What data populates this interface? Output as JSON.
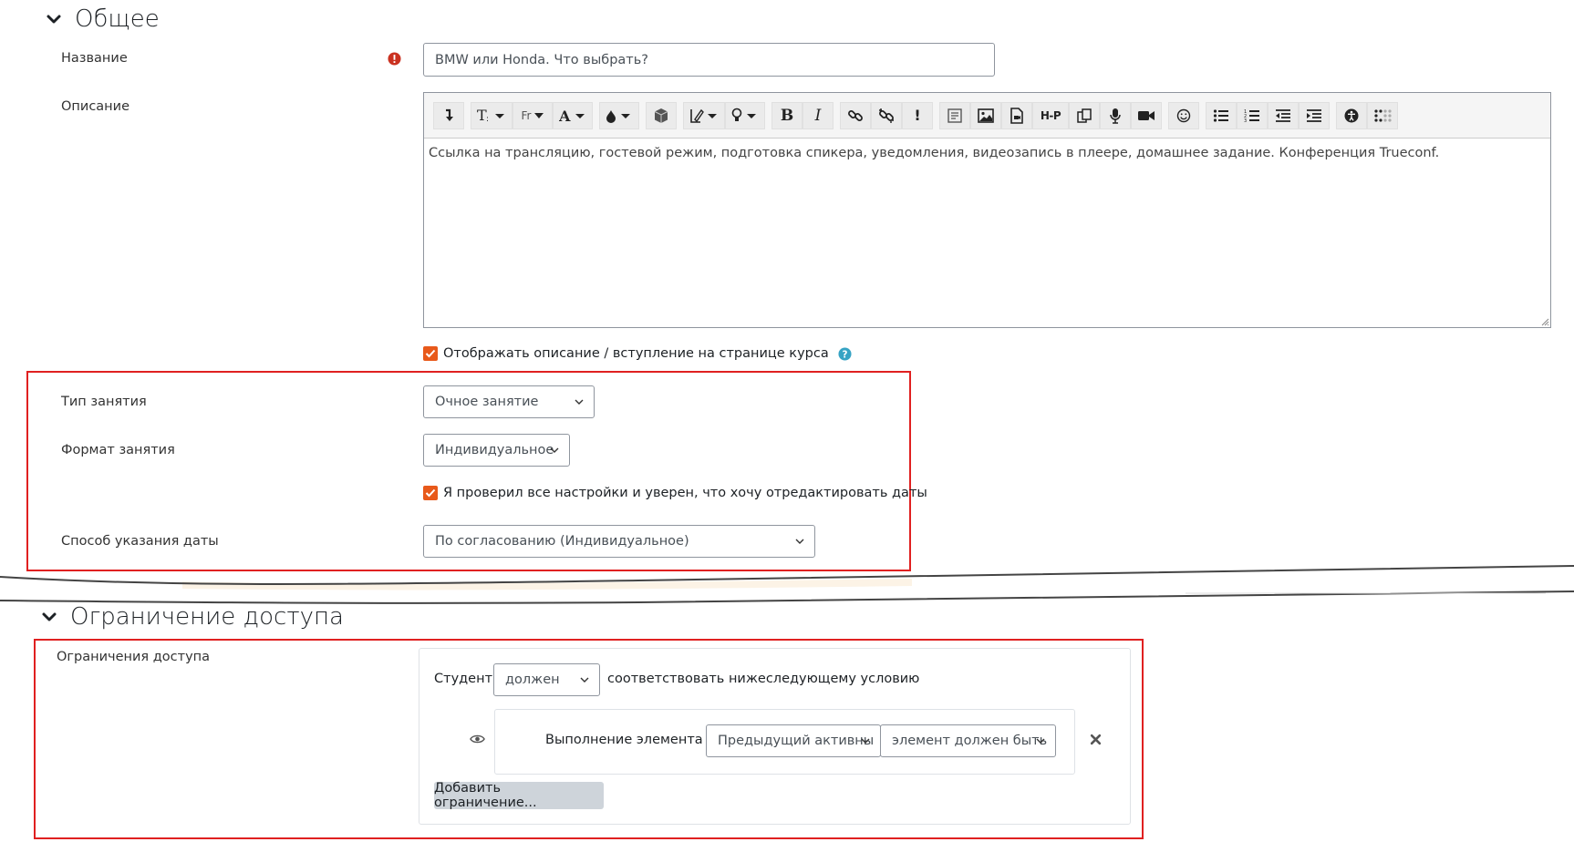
{
  "section_general": {
    "title": "Общее"
  },
  "name_field": {
    "label": "Название",
    "value": "BMW или Honda. Что выбрать?"
  },
  "description_field": {
    "label": "Описание",
    "content": "Ссылка на трансляцию, гостевой режим, подготовка спикера, уведомления, видеозапись в плеере, домашнее задание. Конференция Trueconf.",
    "toolbar_text": {
      "bold": "B",
      "italic": "I",
      "warning": "!",
      "h5p": "H-P",
      "font": "Fr"
    }
  },
  "show_description": {
    "label": "Отображать описание / вступление на странице курса",
    "checked": true
  },
  "lesson_type": {
    "label": "Тип занятия",
    "value": "Очное занятие"
  },
  "lesson_format": {
    "label": "Формат занятия",
    "value": "Индивидуальное"
  },
  "confirm_dates": {
    "label": "Я проверил все настройки и уверен, что хочу отредактировать даты",
    "checked": true
  },
  "date_method": {
    "label": "Способ указания даты",
    "value": "По согласованию (Индивидуальное)"
  },
  "section_access": {
    "title": "Ограничение доступа"
  },
  "access_restrictions": {
    "label": "Ограничения доступа",
    "student_label": "Студент",
    "must_value": "должен",
    "condition_text": "соответствовать нижеследующему условию",
    "completion_label": "Выполнение элемента",
    "activity_value": "Предыдущий активны",
    "state_value": "элемент должен быть",
    "add_button": "Добавить ограничение..."
  },
  "colors": {
    "accent": "#e8591a",
    "required": "#ca3120",
    "highlight_border": "#e02020",
    "help": "#36a3c4"
  }
}
